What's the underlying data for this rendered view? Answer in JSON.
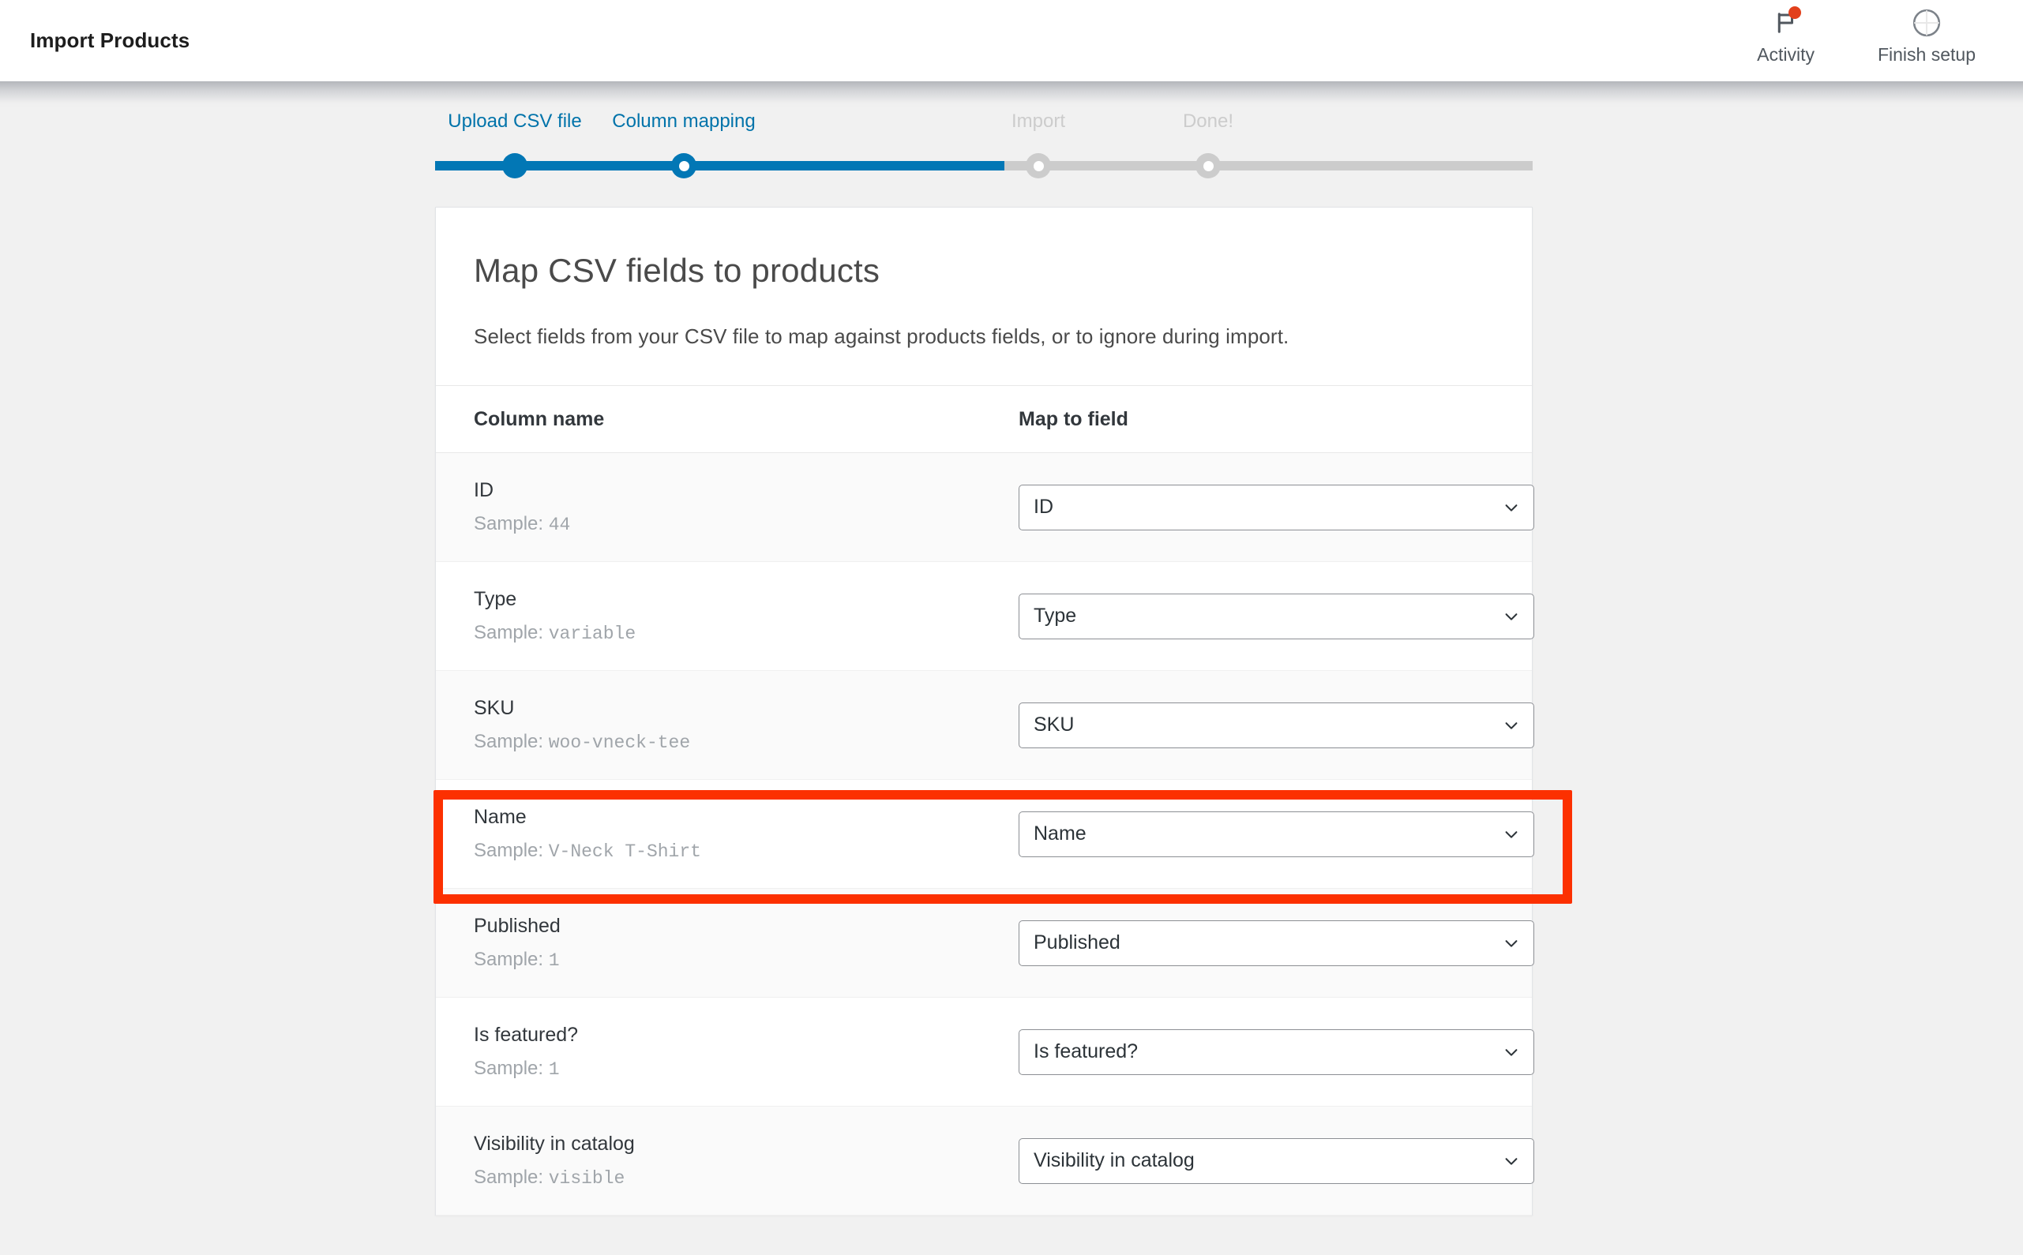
{
  "topbar": {
    "title": "Import Products",
    "actions": [
      {
        "label": "Activity",
        "icon": "flag-icon",
        "badge": true
      },
      {
        "label": "Finish setup",
        "icon": "progress-circle-icon",
        "badge": false
      }
    ]
  },
  "stepper": {
    "steps": [
      {
        "label": "Upload CSV file",
        "state": "done"
      },
      {
        "label": "Column mapping",
        "state": "active"
      },
      {
        "label": "Import",
        "state": "todo"
      },
      {
        "label": "Done!",
        "state": "todo"
      }
    ],
    "active_color": "#0073aa",
    "track_color": "#cccccc",
    "fill_color": "#0277b5",
    "todo_color": "#cccccc"
  },
  "card": {
    "title": "Map CSV fields to products",
    "description": "Select fields from your CSV file to map against products fields, or to ignore during import.",
    "table": {
      "headers": [
        "Column name",
        "Map to field"
      ],
      "sample_prefix": "Sample:",
      "rows": [
        {
          "name": "ID",
          "sample": "44",
          "mapped": "ID"
        },
        {
          "name": "Type",
          "sample": "variable",
          "mapped": "Type"
        },
        {
          "name": "SKU",
          "sample": "woo-vneck-tee",
          "mapped": "SKU"
        },
        {
          "name": "Name",
          "sample": "V-Neck T-Shirt",
          "mapped": "Name"
        },
        {
          "name": "Published",
          "sample": "1",
          "mapped": "Published"
        },
        {
          "name": "Is featured?",
          "sample": "1",
          "mapped": "Is featured?"
        },
        {
          "name": "Visibility in catalog",
          "sample": "visible",
          "mapped": "Visibility in catalog"
        }
      ]
    }
  },
  "annotation": {
    "target_row": "Name",
    "color": "#fc3000"
  }
}
